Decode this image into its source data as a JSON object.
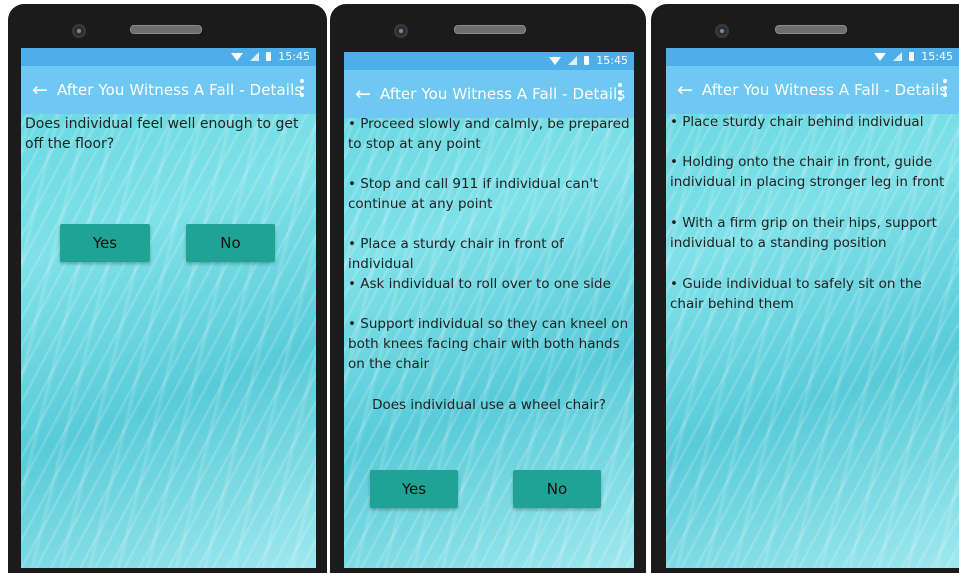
{
  "status": {
    "time": "15:45"
  },
  "colors": {
    "status_bar": "#4eaee8",
    "app_bar": "#6ec8f2",
    "button": "#20a394"
  },
  "screens": [
    {
      "title": "After You Witness A Fall - Details",
      "question": "Does individual feel well enough to get off the floor?",
      "yes": "Yes",
      "no": "No"
    },
    {
      "title": "After You Witness A Fall - Details",
      "steps": [
        "• Proceed slowly and calmly, be prepared to stop at any point",
        "• Stop and call 911 if individual can't continue at any point",
        "• Place a sturdy chair in front of individual",
        "• Ask individual to roll over to one side",
        "• Support individual so they can kneel on both knees facing chair with both hands on the chair"
      ],
      "question": "Does individual use a wheel chair?",
      "yes": "Yes",
      "no": "No"
    },
    {
      "title": "After You Witness A Fall - Details",
      "steps": [
        "• Place sturdy chair behind individual",
        "• Holding onto the chair in front, guide individual in placing stronger leg in front",
        "• With a firm grip on their hips, support individual to a standing position",
        "• Guide individual to safely sit on the chair behind them"
      ]
    }
  ],
  "icons": {
    "back": "arrow-left-icon",
    "more": "more-vert-icon"
  }
}
